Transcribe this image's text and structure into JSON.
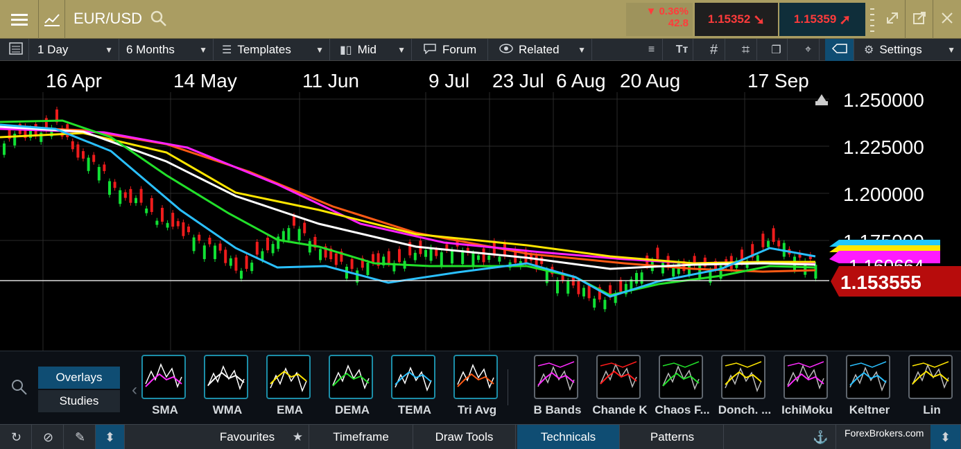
{
  "header": {
    "symbol": "EUR/USD",
    "change_pct": "▼ 0.36%",
    "change_pts": "42.8",
    "sell_price": "1.15352",
    "buy_price": "1.15359"
  },
  "toolbar": {
    "interval": "1 Day",
    "range": "6 Months",
    "templates": "Templates",
    "price_type": "Mid",
    "forum": "Forum",
    "related": "Related",
    "settings": "Settings"
  },
  "chart": {
    "date_labels": [
      "16 Apr",
      "14 May",
      "11 Jun",
      "9 Jul",
      "23 Jul",
      "6 Aug",
      "20 Aug",
      "17 Sep"
    ],
    "price_labels": [
      "1.250000",
      "1.225000",
      "1.200000",
      "1.175000"
    ],
    "current_price": "1.153555",
    "hidden_label": "1.160664"
  },
  "technicals": {
    "tabs": [
      "Overlays",
      "Studies"
    ],
    "overlays": [
      "SMA",
      "WMA",
      "EMA",
      "DEMA",
      "TEMA",
      "Tri Avg"
    ],
    "overlays_displayed": [
      "SMA",
      "WMA",
      "EMA",
      "DEMA",
      "TEMA",
      "Tri Avg"
    ],
    "bands": [
      "B Bands",
      "Chande K",
      "Chaos F...",
      "Donch. ...",
      "IchiMoku",
      "Keltner",
      "Lin"
    ]
  },
  "bottom": {
    "tabs": [
      "Favourites",
      "Timeframe",
      "Draw Tools",
      "Technicals",
      "Patterns"
    ],
    "watermark": "ForexBrokers.com"
  },
  "colors": {
    "header_bg": "#aa9d62",
    "accent_blue": "#0f4d73",
    "down_red": "#ff3b3b",
    "price_tag": "#b70c0c"
  }
}
